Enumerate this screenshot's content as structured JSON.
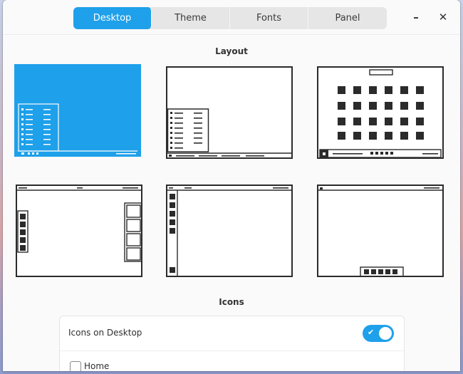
{
  "tabs": [
    {
      "label": "Desktop",
      "active": true
    },
    {
      "label": "Theme",
      "active": false
    },
    {
      "label": "Fonts",
      "active": false
    },
    {
      "label": "Panel",
      "active": false
    }
  ],
  "window_controls": {
    "minimize": "–",
    "close": "✕"
  },
  "sections": {
    "layout_title": "Layout",
    "icons_title": "Icons"
  },
  "layouts": [
    {
      "name": "windows-style",
      "selected": true
    },
    {
      "name": "gnome2-style",
      "selected": false
    },
    {
      "name": "mac-style-dock",
      "selected": false
    },
    {
      "name": "side-docks",
      "selected": false
    },
    {
      "name": "left-panel",
      "selected": false
    },
    {
      "name": "bottom-dock",
      "selected": false
    }
  ],
  "icons": {
    "icons_on_desktop_label": "Icons on Desktop",
    "icons_on_desktop_enabled": true,
    "home_label": "Home",
    "home_checked": false
  },
  "colors": {
    "accent": "#1fa0ea",
    "outline": "#2b2b2b"
  }
}
